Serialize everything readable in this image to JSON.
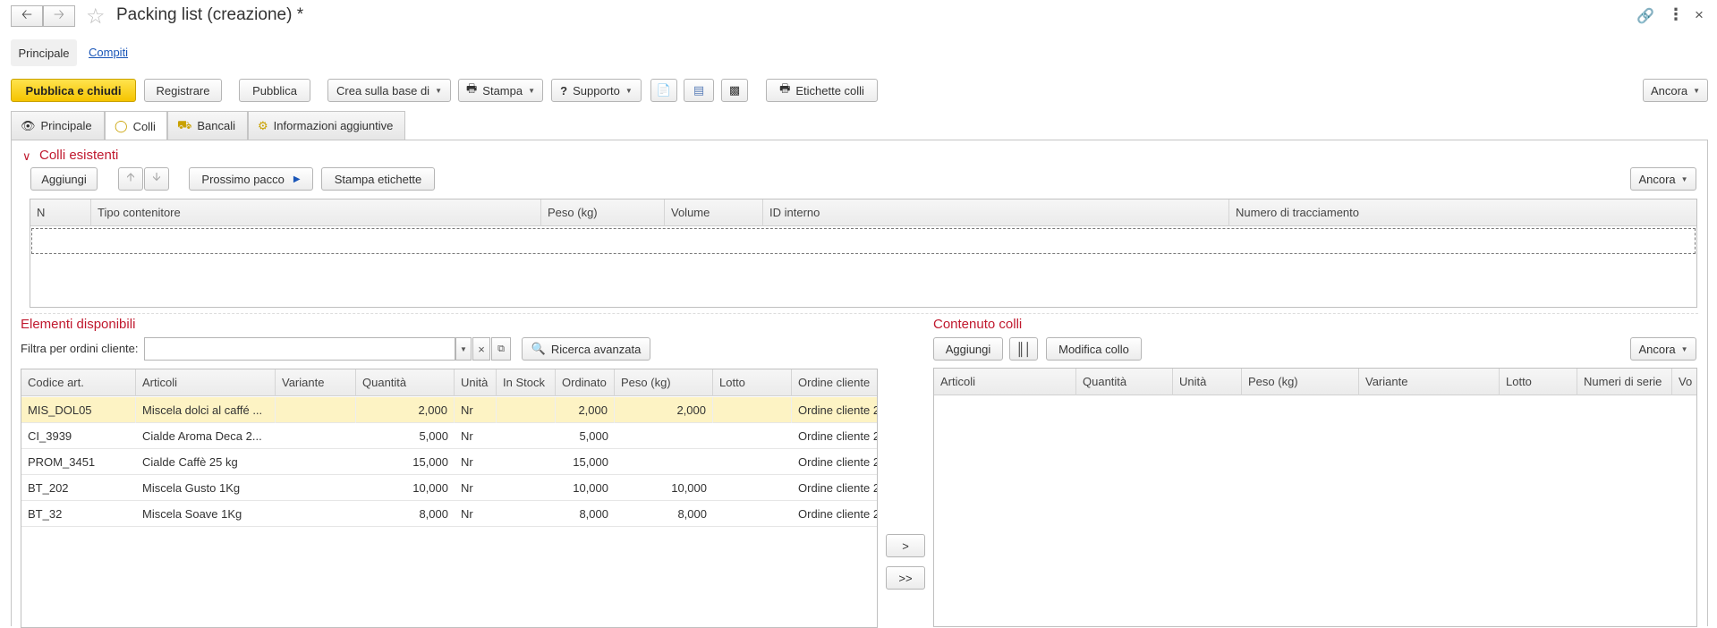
{
  "window": {
    "title": "Packing list (creazione) *"
  },
  "form_tabs": {
    "principale": "Principale",
    "compiti": "Compiti"
  },
  "toolbar": {
    "publish_close": "Pubblica e chiudi",
    "register": "Registrare",
    "publish": "Pubblica",
    "create_based_on": "Crea sulla base di",
    "print": "Stampa",
    "support": "Supporto",
    "package_labels": "Etichette colli",
    "more": "Ancora"
  },
  "tabs": [
    {
      "label": "Principale",
      "icon": "eye-icon"
    },
    {
      "label": "Colli",
      "icon": "package-icon"
    },
    {
      "label": "Bancali",
      "icon": "truck-icon"
    },
    {
      "label": "Informazioni aggiuntive",
      "icon": "info-settings-icon"
    }
  ],
  "colli_esistenti": {
    "title": "Colli esistenti",
    "add": "Aggiungi",
    "next_package": "Prossimo pacco",
    "print_labels": "Stampa etichette",
    "more": "Ancora",
    "columns": [
      "N",
      "Tipo contenitore",
      "Peso (kg)",
      "Volume",
      "ID interno",
      "Numero di tracciamento"
    ]
  },
  "elementi_disponibili": {
    "title": "Elementi disponibili",
    "filter_label": "Filtra per ordini cliente:",
    "filter_value": "",
    "advanced_search": "Ricerca avanzata",
    "columns": [
      "Codice art.",
      "Articoli",
      "Variante",
      "Quantità",
      "Unità",
      "In Stock",
      "Ordinato",
      "Peso (kg)",
      "Lotto",
      "Ordine cliente"
    ],
    "rows": [
      {
        "code": "MIS_DOL05",
        "item": "Miscela dolci al caffé ...",
        "variant": "",
        "qty": "2,000",
        "unit": "Nr",
        "stock": "",
        "ordered": "2,000",
        "weight": "2,000",
        "lot": "",
        "order": "Ordine cliente 2"
      },
      {
        "code": "CI_3939",
        "item": "Cialde Aroma Deca 2...",
        "variant": "",
        "qty": "5,000",
        "unit": "Nr",
        "stock": "",
        "ordered": "5,000",
        "weight": "",
        "lot": "",
        "order": "Ordine cliente 2"
      },
      {
        "code": "PROM_3451",
        "item": "Cialde Caffè 25 kg",
        "variant": "",
        "qty": "15,000",
        "unit": "Nr",
        "stock": "",
        "ordered": "15,000",
        "weight": "",
        "lot": "",
        "order": "Ordine cliente 2"
      },
      {
        "code": "BT_202",
        "item": "Miscela Gusto 1Kg",
        "variant": "",
        "qty": "10,000",
        "unit": "Nr",
        "stock": "",
        "ordered": "10,000",
        "weight": "10,000",
        "lot": "",
        "order": "Ordine cliente 2"
      },
      {
        "code": "BT_32",
        "item": "Miscela Soave 1Kg",
        "variant": "",
        "qty": "8,000",
        "unit": "Nr",
        "stock": "",
        "ordered": "8,000",
        "weight": "8,000",
        "lot": "",
        "order": "Ordine cliente 2"
      }
    ]
  },
  "transfer": {
    "one": ">",
    "all": ">>"
  },
  "contenuto_colli": {
    "title": "Contenuto colli",
    "add": "Aggiungi",
    "edit_package": "Modifica collo",
    "more": "Ancora",
    "columns": [
      "Articoli",
      "Quantità",
      "Unità",
      "Peso (kg)",
      "Variante",
      "Lotto",
      "Numeri di serie",
      "Vo"
    ]
  }
}
